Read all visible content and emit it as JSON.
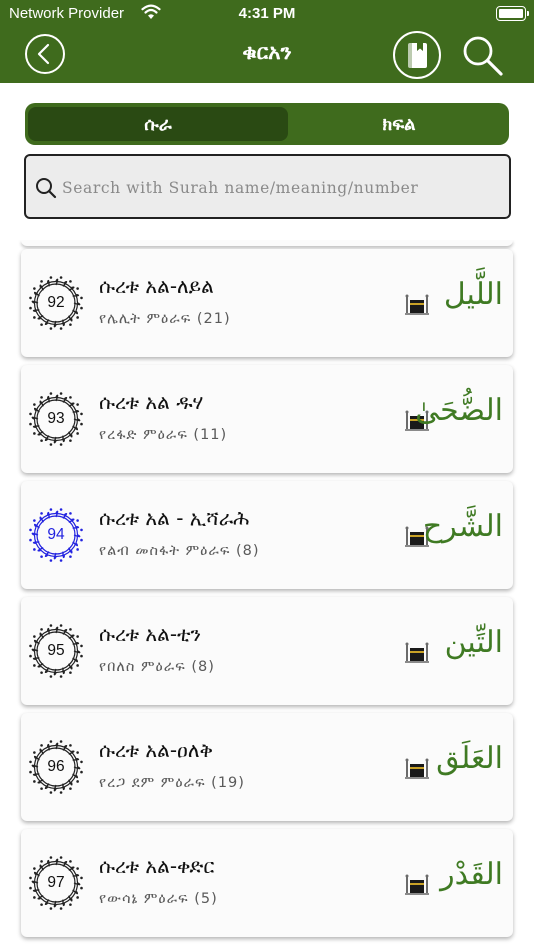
{
  "status_bar": {
    "carrier": "Network Provider",
    "time": "4:31 PM"
  },
  "nav": {
    "title": "ቁርአን"
  },
  "tabs": [
    {
      "label": "ሱራ",
      "active": true
    },
    {
      "label": "ክፍል",
      "active": false
    }
  ],
  "search": {
    "placeholder": "Search with Surah name/meaning/number",
    "value": ""
  },
  "colors": {
    "brand_green": "#3f6b1d",
    "dark_green": "#2a4a13",
    "highlight_blue": "#2323e0",
    "arabic_green": "#3f7a23"
  },
  "surahs": [
    {
      "number": "92",
      "name": "ሱረቱ አል-ለይል",
      "meaning": "የሌሊት ምዕራፍ (21)",
      "arabic": "اللَّيل",
      "highlighted": false,
      "icon": "kaaba-icon"
    },
    {
      "number": "93",
      "name": "ሱረቱ አል ዱሃ",
      "meaning": "የረፋድ ምዕራፍ (11)",
      "arabic": "الضُّحَىٰ",
      "highlighted": false,
      "icon": "kaaba-icon"
    },
    {
      "number": "94",
      "name": "ሱረቱ አል - ኢሻራሕ",
      "meaning": "የልብ መስፋት ምዕራፍ (8)",
      "arabic": "الشَّرح",
      "highlighted": true,
      "icon": "kaaba-icon"
    },
    {
      "number": "95",
      "name": "ሱረቱ አል-ቲን",
      "meaning": "የበለስ ምዕራፍ (8)",
      "arabic": "التِّين",
      "highlighted": false,
      "icon": "kaaba-icon"
    },
    {
      "number": "96",
      "name": "ሱረቱ አል-ዐለቅ",
      "meaning": "የረጋ ደም ምዕራፍ (19)",
      "arabic": "العَلَق",
      "highlighted": false,
      "icon": "kaaba-icon"
    },
    {
      "number": "97",
      "name": "ሱረቱ አል-ቀድር",
      "meaning": "የውሳኔ ምዕራፍ (5)",
      "arabic": "القَدْر",
      "highlighted": false,
      "icon": "kaaba-icon"
    }
  ]
}
